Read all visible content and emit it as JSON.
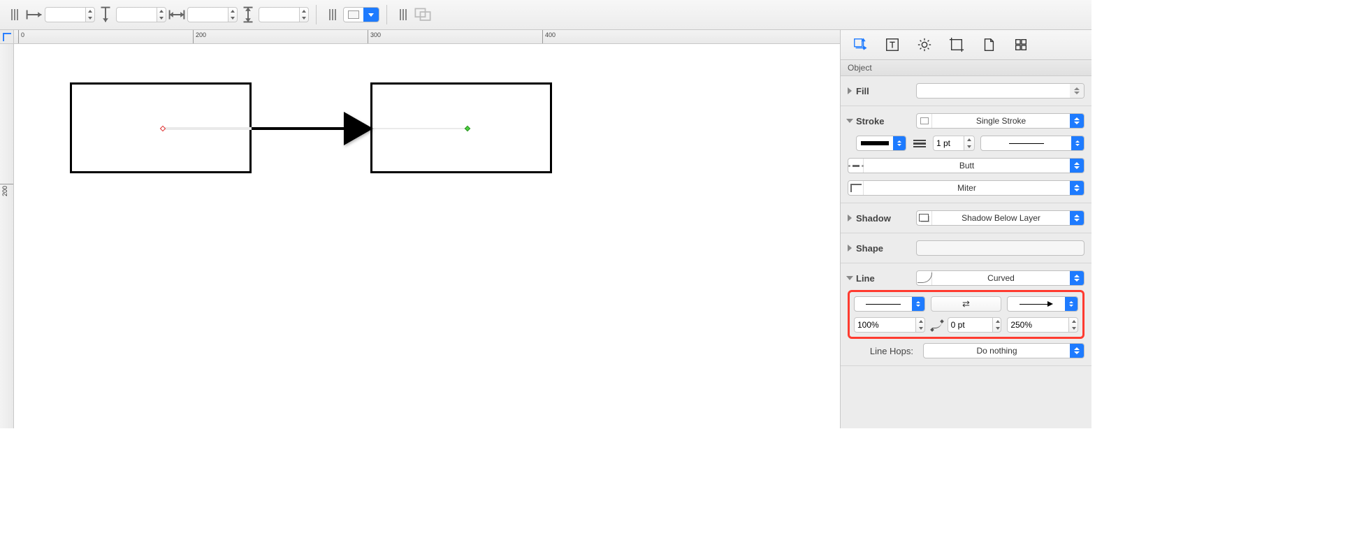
{
  "ruler": {
    "marks": [
      "0",
      "200",
      "300",
      "400"
    ],
    "vmark": "200"
  },
  "inspector": {
    "header": "Object",
    "fill": {
      "title": "Fill"
    },
    "stroke": {
      "title": "Stroke",
      "style": "Single Stroke",
      "width": "1 pt",
      "cap": "Butt",
      "join": "Miter"
    },
    "shadow": {
      "title": "Shadow",
      "mode": "Shadow Below Layer"
    },
    "shape": {
      "title": "Shape"
    },
    "line": {
      "title": "Line",
      "type": "Curved",
      "tail_scale": "100%",
      "corner_radius": "0 pt",
      "head_scale": "250%",
      "hops_label": "Line Hops:",
      "hops_value": "Do nothing"
    }
  }
}
